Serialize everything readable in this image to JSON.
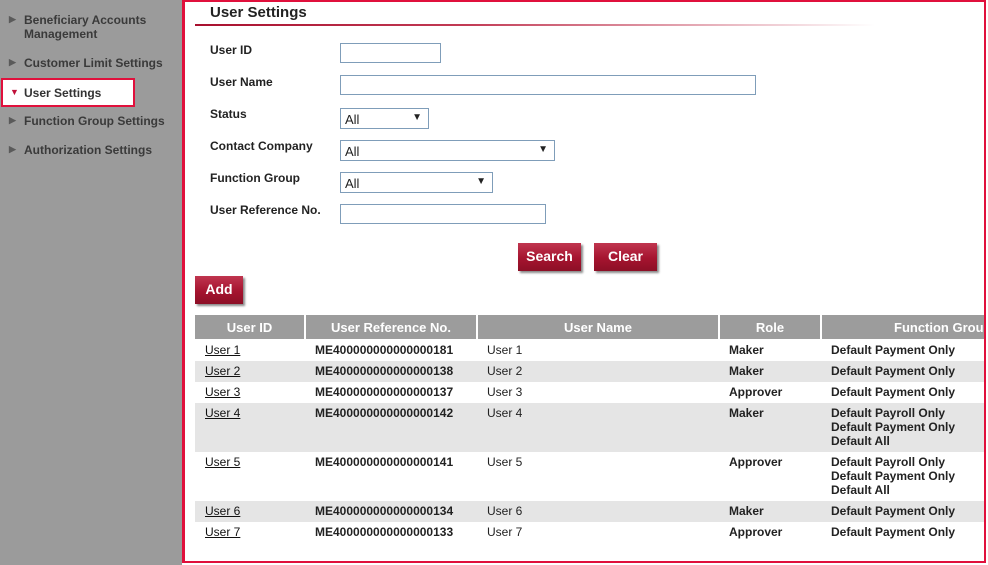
{
  "sidebar": {
    "items": [
      {
        "label_line1": "Beneficiary Accounts",
        "label_line2": "Management",
        "arrow": "▶"
      },
      {
        "label": "Customer Limit Settings",
        "arrow": "▶"
      },
      {
        "label": "User Settings",
        "arrow": "▼"
      },
      {
        "label": "Function Group Settings",
        "arrow": "▶"
      },
      {
        "label": "Authorization Settings",
        "arrow": "▶"
      }
    ]
  },
  "page": {
    "title": "User Settings"
  },
  "form": {
    "user_id_label": "User ID",
    "user_id_value": "",
    "user_name_label": "User Name",
    "user_name_value": "",
    "status_label": "Status",
    "status_value": "All",
    "contact_company_label": "Contact Company",
    "contact_company_value": "All",
    "function_group_label": "Function Group",
    "function_group_value": "All",
    "user_ref_label": "User Reference No.",
    "user_ref_value": "",
    "search_label": "Search",
    "clear_label": "Clear",
    "add_label": "Add"
  },
  "table": {
    "headers": [
      "User ID",
      "User Reference No.",
      "User Name",
      "Role",
      "Function Grou"
    ],
    "rows": [
      {
        "user_id": "User 1",
        "ref": "ME400000000000000181",
        "name": "User 1",
        "role": "Maker",
        "groups": [
          "Default Payment Only"
        ]
      },
      {
        "user_id": "User 2",
        "ref": "ME400000000000000138",
        "name": "User 2",
        "role": "Maker",
        "groups": [
          "Default Payment Only"
        ]
      },
      {
        "user_id": "User 3",
        "ref": "ME400000000000000137",
        "name": "User 3",
        "role": "Approver",
        "groups": [
          "Default Payment Only"
        ]
      },
      {
        "user_id": "User 4",
        "ref": "ME400000000000000142",
        "name": "User 4",
        "role": "Maker",
        "groups": [
          "Default Payroll Only",
          "Default Payment Only",
          "Default All"
        ]
      },
      {
        "user_id": "User 5",
        "ref": "ME400000000000000141",
        "name": "User 5",
        "role": "Approver",
        "groups": [
          "Default Payroll Only",
          "Default Payment Only",
          "Default All"
        ]
      },
      {
        "user_id": "User 6",
        "ref": "ME400000000000000134",
        "name": "User 6",
        "role": "Maker",
        "groups": [
          "Default Payment Only"
        ]
      },
      {
        "user_id": "User 7",
        "ref": "ME400000000000000133",
        "name": "User 7",
        "role": "Approver",
        "groups": [
          "Default Payment Only"
        ]
      }
    ]
  },
  "colors": {
    "accent": "#e0103c",
    "button": "#a5142f",
    "sidebar_bg": "#9b9b9b",
    "header_bg": "#9c9c9c",
    "row_alt": "#e5e5e5"
  }
}
